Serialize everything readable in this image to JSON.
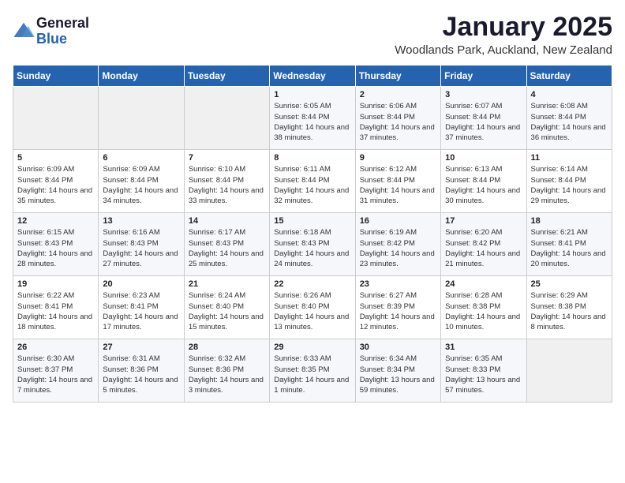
{
  "header": {
    "logo": {
      "text_general": "General",
      "text_blue": "Blue"
    },
    "title": "January 2025",
    "subtitle": "Woodlands Park, Auckland, New Zealand"
  },
  "calendar": {
    "days_of_week": [
      "Sunday",
      "Monday",
      "Tuesday",
      "Wednesday",
      "Thursday",
      "Friday",
      "Saturday"
    ],
    "weeks": [
      [
        {
          "day": null
        },
        {
          "day": null
        },
        {
          "day": null
        },
        {
          "day": "1",
          "sunrise": "6:05 AM",
          "sunset": "8:44 PM",
          "daylight": "14 hours and 38 minutes."
        },
        {
          "day": "2",
          "sunrise": "6:06 AM",
          "sunset": "8:44 PM",
          "daylight": "14 hours and 37 minutes."
        },
        {
          "day": "3",
          "sunrise": "6:07 AM",
          "sunset": "8:44 PM",
          "daylight": "14 hours and 37 minutes."
        },
        {
          "day": "4",
          "sunrise": "6:08 AM",
          "sunset": "8:44 PM",
          "daylight": "14 hours and 36 minutes."
        }
      ],
      [
        {
          "day": "5",
          "sunrise": "6:09 AM",
          "sunset": "8:44 PM",
          "daylight": "14 hours and 35 minutes."
        },
        {
          "day": "6",
          "sunrise": "6:09 AM",
          "sunset": "8:44 PM",
          "daylight": "14 hours and 34 minutes."
        },
        {
          "day": "7",
          "sunrise": "6:10 AM",
          "sunset": "8:44 PM",
          "daylight": "14 hours and 33 minutes."
        },
        {
          "day": "8",
          "sunrise": "6:11 AM",
          "sunset": "8:44 PM",
          "daylight": "14 hours and 32 minutes."
        },
        {
          "day": "9",
          "sunrise": "6:12 AM",
          "sunset": "8:44 PM",
          "daylight": "14 hours and 31 minutes."
        },
        {
          "day": "10",
          "sunrise": "6:13 AM",
          "sunset": "8:44 PM",
          "daylight": "14 hours and 30 minutes."
        },
        {
          "day": "11",
          "sunrise": "6:14 AM",
          "sunset": "8:44 PM",
          "daylight": "14 hours and 29 minutes."
        }
      ],
      [
        {
          "day": "12",
          "sunrise": "6:15 AM",
          "sunset": "8:43 PM",
          "daylight": "14 hours and 28 minutes."
        },
        {
          "day": "13",
          "sunrise": "6:16 AM",
          "sunset": "8:43 PM",
          "daylight": "14 hours and 27 minutes."
        },
        {
          "day": "14",
          "sunrise": "6:17 AM",
          "sunset": "8:43 PM",
          "daylight": "14 hours and 25 minutes."
        },
        {
          "day": "15",
          "sunrise": "6:18 AM",
          "sunset": "8:43 PM",
          "daylight": "14 hours and 24 minutes."
        },
        {
          "day": "16",
          "sunrise": "6:19 AM",
          "sunset": "8:42 PM",
          "daylight": "14 hours and 23 minutes."
        },
        {
          "day": "17",
          "sunrise": "6:20 AM",
          "sunset": "8:42 PM",
          "daylight": "14 hours and 21 minutes."
        },
        {
          "day": "18",
          "sunrise": "6:21 AM",
          "sunset": "8:41 PM",
          "daylight": "14 hours and 20 minutes."
        }
      ],
      [
        {
          "day": "19",
          "sunrise": "6:22 AM",
          "sunset": "8:41 PM",
          "daylight": "14 hours and 18 minutes."
        },
        {
          "day": "20",
          "sunrise": "6:23 AM",
          "sunset": "8:41 PM",
          "daylight": "14 hours and 17 minutes."
        },
        {
          "day": "21",
          "sunrise": "6:24 AM",
          "sunset": "8:40 PM",
          "daylight": "14 hours and 15 minutes."
        },
        {
          "day": "22",
          "sunrise": "6:26 AM",
          "sunset": "8:40 PM",
          "daylight": "14 hours and 13 minutes."
        },
        {
          "day": "23",
          "sunrise": "6:27 AM",
          "sunset": "8:39 PM",
          "daylight": "14 hours and 12 minutes."
        },
        {
          "day": "24",
          "sunrise": "6:28 AM",
          "sunset": "8:38 PM",
          "daylight": "14 hours and 10 minutes."
        },
        {
          "day": "25",
          "sunrise": "6:29 AM",
          "sunset": "8:38 PM",
          "daylight": "14 hours and 8 minutes."
        }
      ],
      [
        {
          "day": "26",
          "sunrise": "6:30 AM",
          "sunset": "8:37 PM",
          "daylight": "14 hours and 7 minutes."
        },
        {
          "day": "27",
          "sunrise": "6:31 AM",
          "sunset": "8:36 PM",
          "daylight": "14 hours and 5 minutes."
        },
        {
          "day": "28",
          "sunrise": "6:32 AM",
          "sunset": "8:36 PM",
          "daylight": "14 hours and 3 minutes."
        },
        {
          "day": "29",
          "sunrise": "6:33 AM",
          "sunset": "8:35 PM",
          "daylight": "14 hours and 1 minute."
        },
        {
          "day": "30",
          "sunrise": "6:34 AM",
          "sunset": "8:34 PM",
          "daylight": "13 hours and 59 minutes."
        },
        {
          "day": "31",
          "sunrise": "6:35 AM",
          "sunset": "8:33 PM",
          "daylight": "13 hours and 57 minutes."
        },
        {
          "day": null
        }
      ]
    ]
  }
}
